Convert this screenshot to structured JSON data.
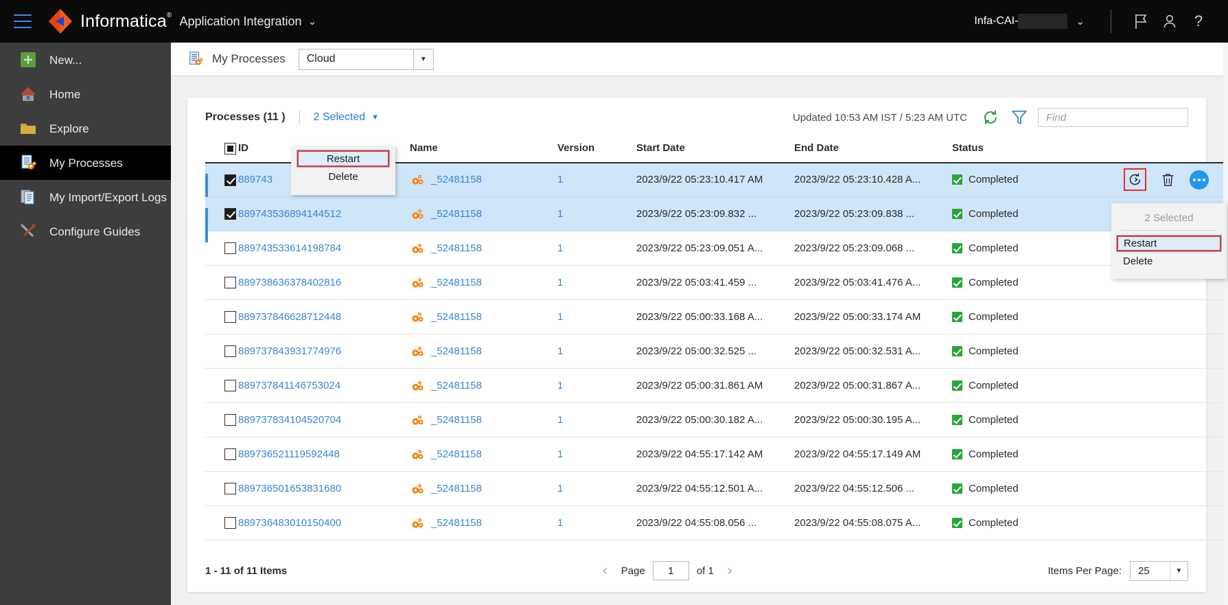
{
  "topbar": {
    "menu_icon": "hamburger-icon",
    "brand": "Informatica",
    "brand_tm": "®",
    "app_name": "Application Integration",
    "app_caret": "⌄",
    "org_label": "Infa-CAI-",
    "org_caret": "⌄",
    "icons": [
      "flag-icon",
      "user-icon",
      "help-icon"
    ]
  },
  "sidebar": {
    "items": [
      {
        "label": "New...",
        "icon": "plus-icon",
        "active": false
      },
      {
        "label": "Home",
        "icon": "home-icon",
        "active": false
      },
      {
        "label": "Explore",
        "icon": "folder-icon",
        "active": false
      },
      {
        "label": "My Processes",
        "icon": "processes-icon",
        "active": true
      },
      {
        "label": "My Import/Export Logs",
        "icon": "logs-icon",
        "active": false
      },
      {
        "label": "Configure Guides",
        "icon": "tools-icon",
        "active": false
      }
    ]
  },
  "subheader": {
    "icon": "processes-icon",
    "title": "My Processes",
    "select_value": "Cloud",
    "select_caret": "▼"
  },
  "card_header": {
    "processes_count": "Processes (11 )",
    "selected_label": "2 Selected",
    "selected_caret": "▼",
    "updated_text": "Updated 10:53 AM IST / 5:23 AM UTC",
    "refresh_icon": "refresh-icon",
    "filter_icon": "filter-icon",
    "find_placeholder": "Find"
  },
  "select_menu_left": {
    "items": [
      {
        "label": "Restart",
        "highlighted": true
      },
      {
        "label": "Delete",
        "highlighted": false
      }
    ]
  },
  "row_action_menu": {
    "title": "2 Selected",
    "items": [
      {
        "label": "Restart",
        "highlighted": true
      },
      {
        "label": "Delete",
        "highlighted": false
      }
    ]
  },
  "table": {
    "columns": [
      "",
      "ID",
      "Name",
      "Version",
      "Start Date",
      "End Date",
      "Status",
      ""
    ],
    "header_checkbox_state": "partial",
    "rows": [
      {
        "checked": true,
        "selected": true,
        "id": "889743",
        "name": "_52481158",
        "version": "1",
        "start": "2023/9/22 05:23:10.417 AM",
        "end": "2023/9/22 05:23:10.428 A...",
        "status": "Completed",
        "actions": true
      },
      {
        "checked": true,
        "selected": true,
        "id": "889743536894144512",
        "name": "_52481158",
        "version": "1",
        "start": "2023/9/22 05:23:09.832 ...",
        "end": "2023/9/22 05:23:09.838 ...",
        "status": "Completed",
        "actions": false
      },
      {
        "checked": false,
        "selected": false,
        "id": "889743533614198784",
        "name": "_52481158",
        "version": "1",
        "start": "2023/9/22 05:23:09.051 A...",
        "end": "2023/9/22 05:23:09.068 ...",
        "status": "Completed",
        "actions": false
      },
      {
        "checked": false,
        "selected": false,
        "id": "889738636378402816",
        "name": "_52481158",
        "version": "1",
        "start": "2023/9/22 05:03:41.459 ...",
        "end": "2023/9/22 05:03:41.476 A...",
        "status": "Completed",
        "actions": false
      },
      {
        "checked": false,
        "selected": false,
        "id": "889737846628712448",
        "name": "_52481158",
        "version": "1",
        "start": "2023/9/22 05:00:33.168 A...",
        "end": "2023/9/22 05:00:33.174 AM",
        "status": "Completed",
        "actions": false
      },
      {
        "checked": false,
        "selected": false,
        "id": "889737843931774976",
        "name": "_52481158",
        "version": "1",
        "start": "2023/9/22 05:00:32.525 ...",
        "end": "2023/9/22 05:00:32.531 A...",
        "status": "Completed",
        "actions": false
      },
      {
        "checked": false,
        "selected": false,
        "id": "889737841146753024",
        "name": "_52481158",
        "version": "1",
        "start": "2023/9/22 05:00:31.861 AM",
        "end": "2023/9/22 05:00:31.867 A...",
        "status": "Completed",
        "actions": false
      },
      {
        "checked": false,
        "selected": false,
        "id": "889737834104520704",
        "name": "_52481158",
        "version": "1",
        "start": "2023/9/22 05:00:30.182 A...",
        "end": "2023/9/22 05:00:30.195 A...",
        "status": "Completed",
        "actions": false
      },
      {
        "checked": false,
        "selected": false,
        "id": "889736521119592448",
        "name": "_52481158",
        "version": "1",
        "start": "2023/9/22 04:55:17.142 AM",
        "end": "2023/9/22 04:55:17.149 AM",
        "status": "Completed",
        "actions": false
      },
      {
        "checked": false,
        "selected": false,
        "id": "889736501653831680",
        "name": "_52481158",
        "version": "1",
        "start": "2023/9/22 04:55:12.501 A...",
        "end": "2023/9/22 04:55:12.506 ...",
        "status": "Completed",
        "actions": false
      },
      {
        "checked": false,
        "selected": false,
        "id": "889736483010150400",
        "name": "_52481158",
        "version": "1",
        "start": "2023/9/22 04:55:08.056 ...",
        "end": "2023/9/22 04:55:08.075 A...",
        "status": "Completed",
        "actions": false
      }
    ]
  },
  "footer": {
    "items_range": "1 - 11 of 11 Items",
    "prev_arrow": "‹",
    "page_label": "Page",
    "page_value": "1",
    "of_label": "of  1",
    "next_arrow": "›",
    "items_per_page_label": "Items Per Page:",
    "items_per_page_value": "25",
    "items_per_page_caret": "▼"
  },
  "colors": {
    "brand_orange": "#f25c19",
    "link_blue": "#3a86d4",
    "selected_row": "#cfe5f8",
    "status_green": "#2aa53a",
    "highlight_red": "#f0322d",
    "accent_blue": "#2196f3"
  }
}
